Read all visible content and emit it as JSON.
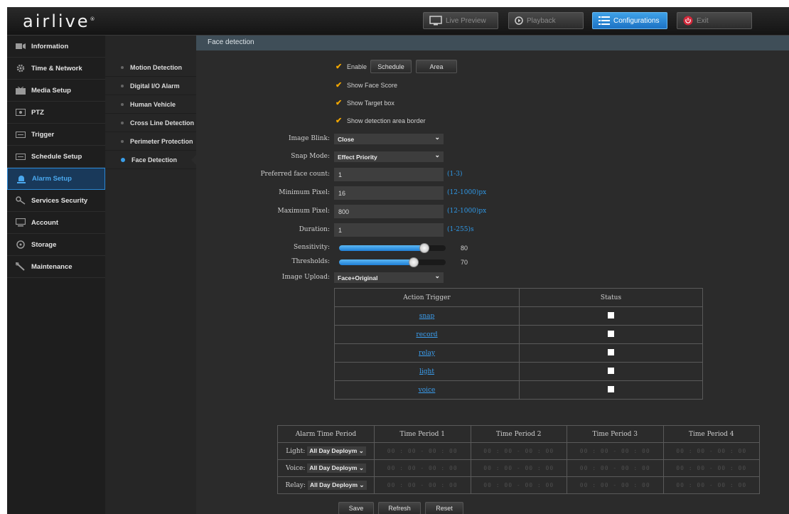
{
  "brand": {
    "logo": "airlive",
    "logo_mark": "®"
  },
  "topnav": {
    "live_preview": "Live Preview",
    "playback": "Playback",
    "configurations": "Configurations",
    "exit": "Exit"
  },
  "sidebar": {
    "items": [
      {
        "label": "Information",
        "icon": "info-icon"
      },
      {
        "label": "Time & Network",
        "icon": "gear-icon"
      },
      {
        "label": "Media Setup",
        "icon": "media-icon"
      },
      {
        "label": "PTZ",
        "icon": "ptz-icon"
      },
      {
        "label": "Trigger",
        "icon": "trigger-icon"
      },
      {
        "label": "Schedule Setup",
        "icon": "schedule-icon"
      },
      {
        "label": "Alarm Setup",
        "icon": "alarm-icon",
        "active": true
      },
      {
        "label": "Services Security",
        "icon": "key-icon"
      },
      {
        "label": "Account",
        "icon": "monitor-icon"
      },
      {
        "label": "Storage",
        "icon": "storage-icon"
      },
      {
        "label": "Maintenance",
        "icon": "wrench-icon"
      }
    ]
  },
  "subnav": {
    "items": [
      {
        "label": "Motion Detection"
      },
      {
        "label": "Digital I/O Alarm"
      },
      {
        "label": "Human Vehicle"
      },
      {
        "label": "Cross Line Detection"
      },
      {
        "label": "Perimeter Protection"
      },
      {
        "label": "Face Detection",
        "active": true
      }
    ]
  },
  "page": {
    "title": "Face detection",
    "enable_label": "Enable",
    "schedule_button": "Schedule",
    "area_button": "Area",
    "show_face_score": "Show Face Score",
    "show_target_box": "Show Target box",
    "show_detection_border": "Show detection area border",
    "image_blink": {
      "label": "Image Blink:",
      "value": "Close"
    },
    "snap_mode": {
      "label": "Snap Mode:",
      "value": "Effect Priority"
    },
    "preferred_face_count": {
      "label": "Preferred face count:",
      "value": "1",
      "range": "(1-3)"
    },
    "minimum_pixel": {
      "label": "Minimum Pixel:",
      "value": "16",
      "range": "(12-1000)px"
    },
    "maximum_pixel": {
      "label": "Maximum Pixel:",
      "value": "800",
      "range": "(12-1000)px"
    },
    "duration": {
      "label": "Duration:",
      "value": "1",
      "range": "(1-255)s"
    },
    "sensitivity": {
      "label": "Sensitivity:",
      "value": "80",
      "max": 100
    },
    "thresholds": {
      "label": "Thresholds:",
      "value": "70",
      "max": 100
    },
    "image_upload": {
      "label": "Image Upload:",
      "value": "Face+Original"
    }
  },
  "action_table": {
    "headers": [
      "Action Trigger",
      "Status"
    ],
    "rows": [
      "snap",
      "record",
      "relay",
      "light",
      "voice"
    ]
  },
  "time_table": {
    "headers": [
      "Alarm Time Period",
      "Time Period 1",
      "Time Period 2",
      "Time Period 3",
      "Time Period 4"
    ],
    "rows": [
      {
        "label": "Light:",
        "mode": "All Day Deploym"
      },
      {
        "label": "Voice:",
        "mode": "All Day Deploym"
      },
      {
        "label": "Relay:",
        "mode": "All Day Deploym"
      }
    ],
    "time_placeholder": "00 : 00 - 00 : 00"
  },
  "footer": {
    "save": "Save",
    "refresh": "Refresh",
    "reset": "Reset"
  },
  "colors": {
    "accent": "#2a86d2",
    "check": "#f2a600",
    "link": "#3b9ff0",
    "exit": "#d4283a"
  }
}
